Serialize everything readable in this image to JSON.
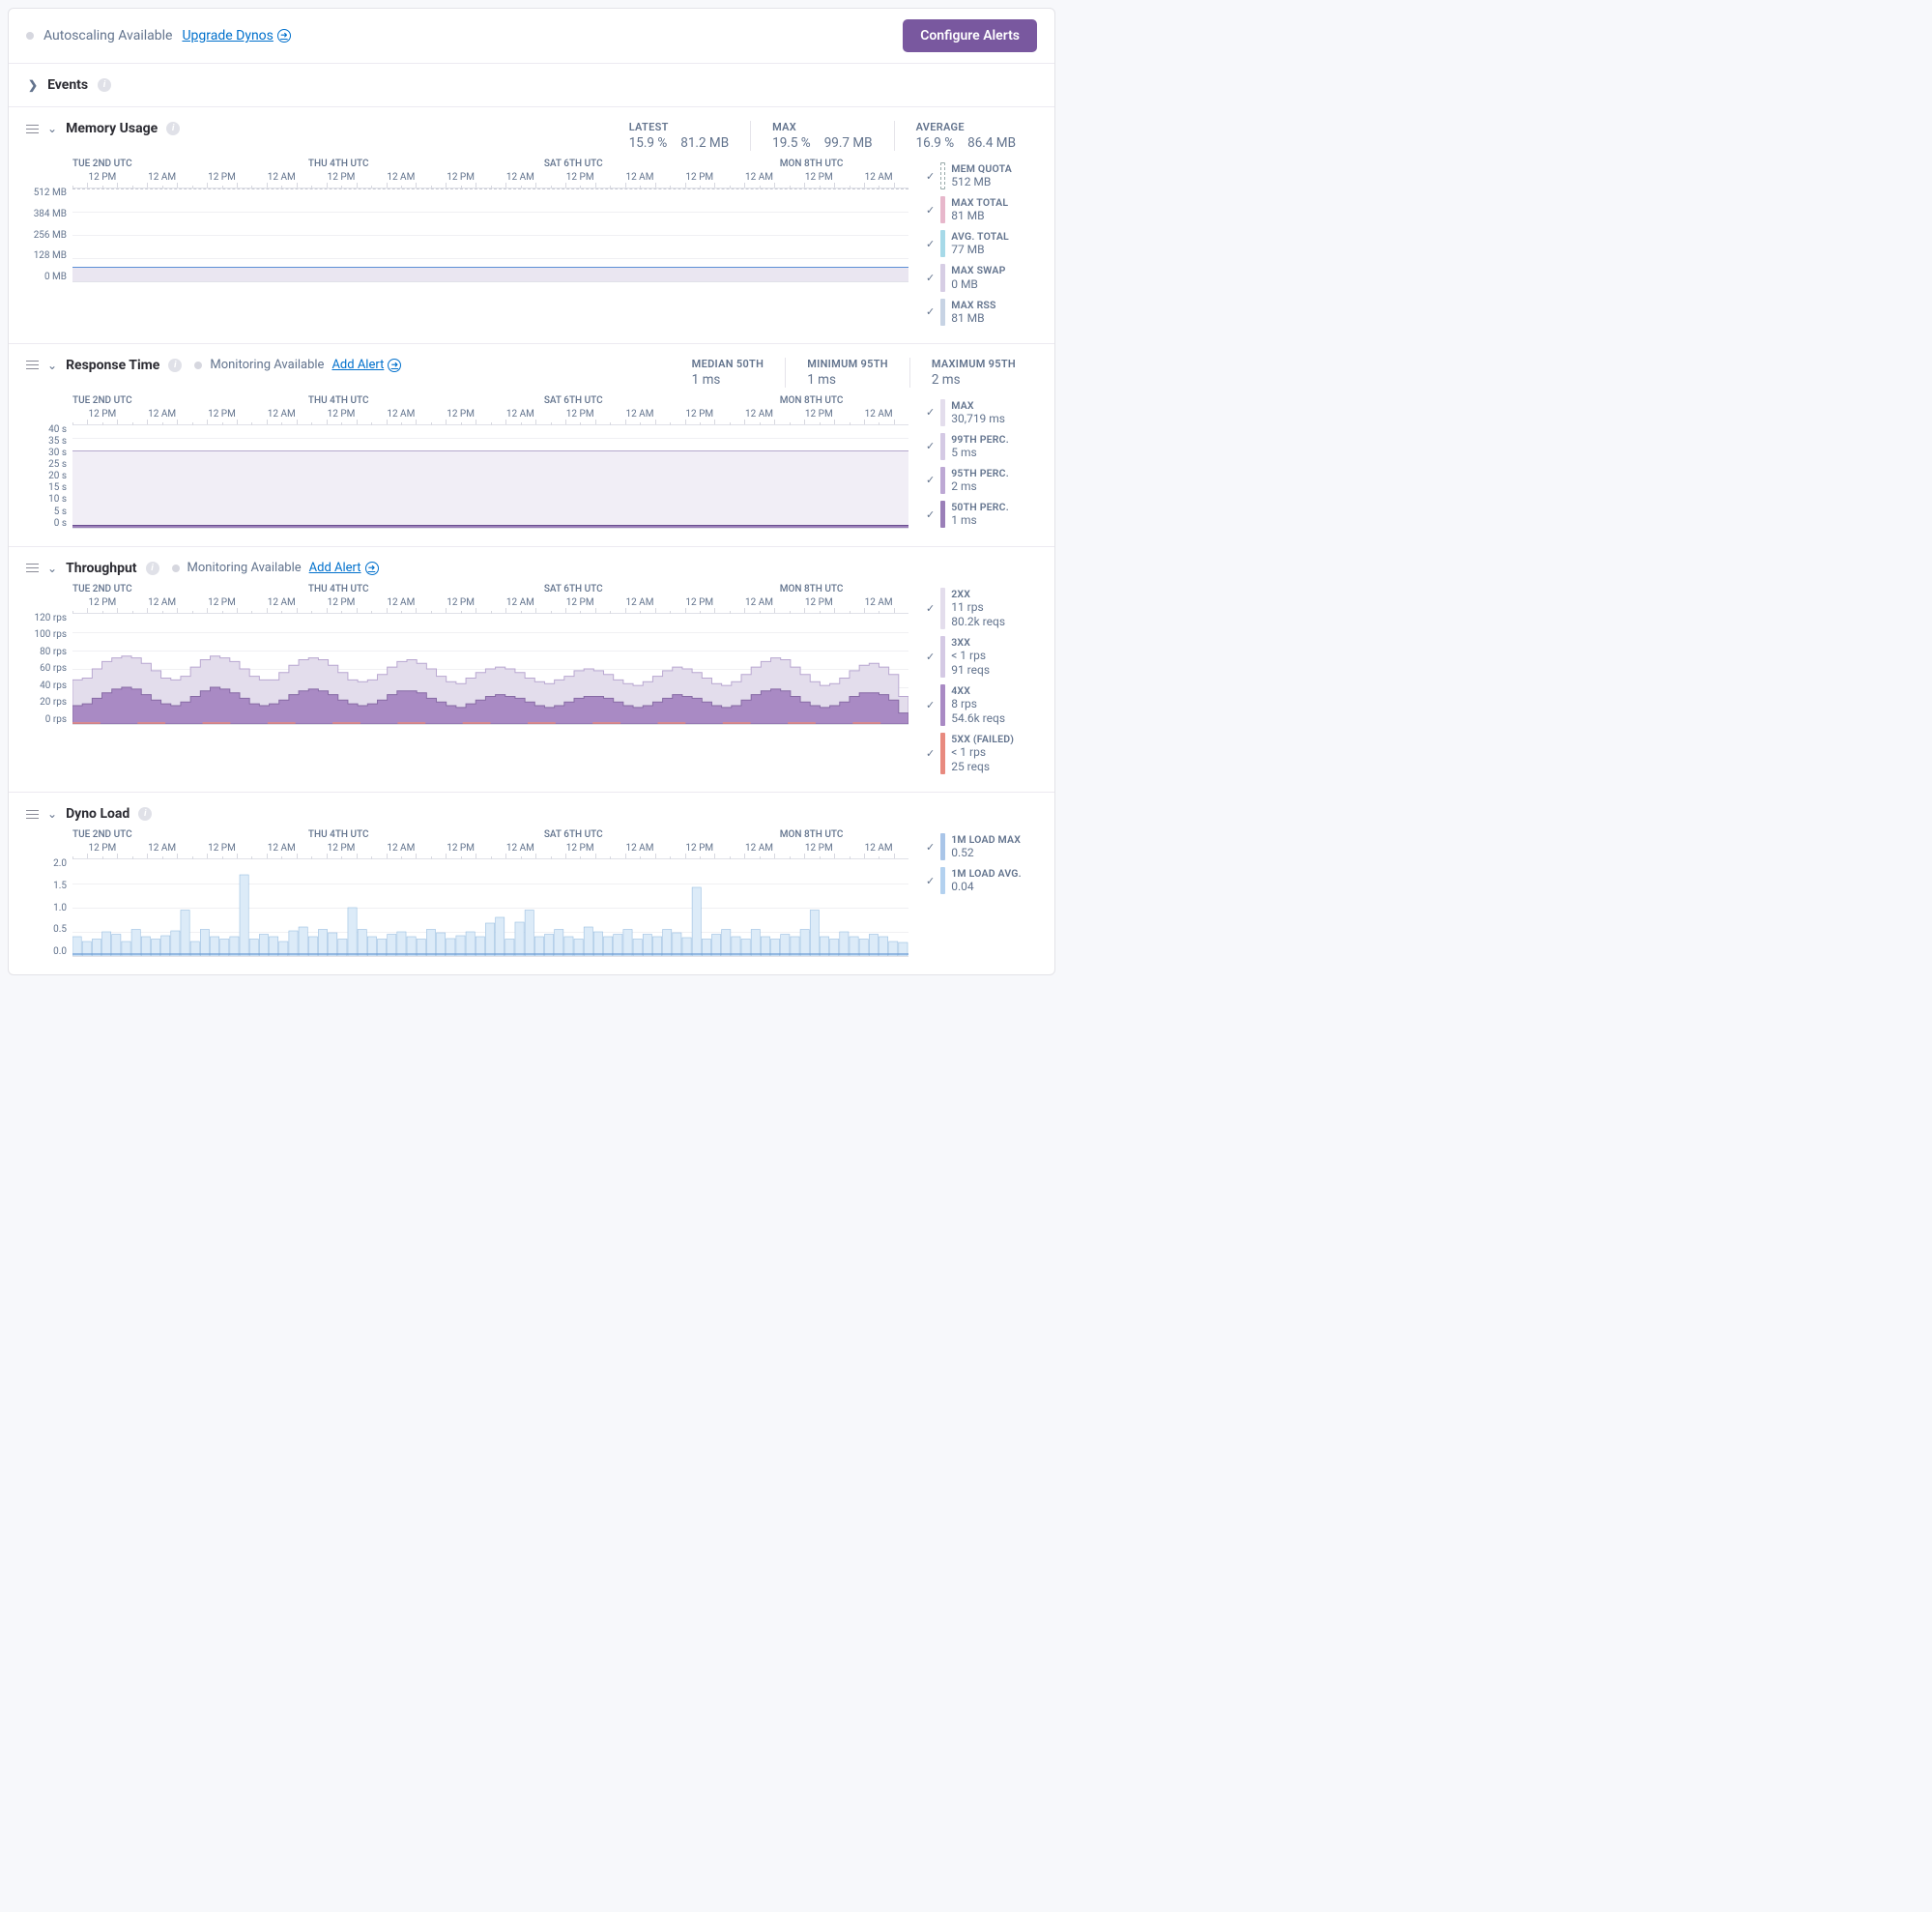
{
  "topbar": {
    "autoscaling_label": "Autoscaling Available",
    "upgrade_label": "Upgrade Dynos",
    "configure_label": "Configure Alerts"
  },
  "events": {
    "label": "Events"
  },
  "time_axis": {
    "days": [
      {
        "label": "TUE 2ND UTC",
        "pct": 0
      },
      {
        "label": "THU 4TH UTC",
        "pct": 28.2
      },
      {
        "label": "SAT 6TH UTC",
        "pct": 56.4
      },
      {
        "label": "MON 8TH UTC",
        "pct": 84.6
      }
    ],
    "ticks": [
      "12 PM",
      "12 AM",
      "12 PM",
      "12 AM",
      "12 PM",
      "12 AM",
      "12 PM",
      "12 AM",
      "12 PM",
      "12 AM",
      "12 PM",
      "12 AM",
      "12 PM",
      "12 AM"
    ]
  },
  "memory": {
    "title": "Memory Usage",
    "stats": {
      "latest_label": "LATEST",
      "latest_pct": "15.9 %",
      "latest_mb": "81.2 MB",
      "max_label": "MAX",
      "max_pct": "19.5 %",
      "max_mb": "99.7 MB",
      "avg_label": "AVERAGE",
      "avg_pct": "16.9 %",
      "avg_mb": "86.4 MB"
    },
    "y_labels": [
      "512 MB",
      "384 MB",
      "256 MB",
      "128 MB",
      "0 MB"
    ],
    "legend": [
      {
        "name": "MEM QUOTA",
        "val": "512 MB",
        "color": "#d9dbe4",
        "dashed": true
      },
      {
        "name": "MAX TOTAL",
        "val": "81 MB",
        "color": "#e7b7cb"
      },
      {
        "name": "AVG. TOTAL",
        "val": "77 MB",
        "color": "#a6d9e8"
      },
      {
        "name": "MAX SWAP",
        "val": "0 MB",
        "color": "#d6cde4"
      },
      {
        "name": "MAX RSS",
        "val": "81 MB",
        "color": "#c7d3e4"
      }
    ],
    "chart_fill_pct": 16
  },
  "response": {
    "title": "Response Time",
    "monitoring_label": "Monitoring Available",
    "addalert_label": "Add Alert",
    "stats": {
      "med_label": "MEDIAN 50TH",
      "med_val": "1 ms",
      "min_label": "MINIMUM 95TH",
      "min_val": "1 ms",
      "max_label": "MAXIMUM 95TH",
      "max_val": "2 ms"
    },
    "y_labels": [
      "40 s",
      "35 s",
      "30 s",
      "25 s",
      "20 s",
      "15 s",
      "10 s",
      "5 s",
      "0 s"
    ],
    "legend": [
      {
        "name": "MAX",
        "val": "30,719 ms",
        "color": "#e3ddec"
      },
      {
        "name": "99TH PERC.",
        "val": "5 ms",
        "color": "#d4c9e4"
      },
      {
        "name": "95TH PERC.",
        "val": "2 ms",
        "color": "#bda8d4"
      },
      {
        "name": "50TH PERC.",
        "val": "1 ms",
        "color": "#9a7fb8"
      }
    ],
    "thirty_line_pct": 25
  },
  "throughput": {
    "title": "Throughput",
    "monitoring_label": "Monitoring Available",
    "addalert_label": "Add Alert",
    "y_labels": [
      "120 rps",
      "100 rps",
      "80 rps",
      "60 rps",
      "40 rps",
      "20 rps",
      "0 rps"
    ],
    "legend": [
      {
        "name": "2XX",
        "val": "11 rps",
        "val2": "80.2k reqs",
        "color": "#e3ddec"
      },
      {
        "name": "3XX",
        "val": "< 1 rps",
        "val2": "91 reqs",
        "color": "#d4c9e4"
      },
      {
        "name": "4XX",
        "val": "8 rps",
        "val2": "54.6k reqs",
        "color": "#a98ac4"
      },
      {
        "name": "5XX (FAILED)",
        "val": "< 1 rps",
        "val2": "25 reqs",
        "color": "#e88a7f"
      }
    ],
    "series_2xx": [
      48,
      50,
      60,
      68,
      72,
      74,
      72,
      66,
      58,
      50,
      48,
      52,
      62,
      70,
      74,
      72,
      68,
      60,
      52,
      48,
      48,
      56,
      64,
      70,
      72,
      70,
      64,
      56,
      48,
      46,
      48,
      54,
      62,
      68,
      70,
      66,
      60,
      52,
      46,
      44,
      50,
      56,
      60,
      62,
      60,
      56,
      50,
      46,
      44,
      48,
      52,
      58,
      60,
      58,
      54,
      48,
      44,
      42,
      46,
      52,
      58,
      62,
      60,
      56,
      50,
      44,
      42,
      46,
      54,
      62,
      68,
      72,
      70,
      62,
      54,
      46,
      42,
      44,
      50,
      58,
      64,
      66,
      62,
      54,
      30
    ],
    "series_4xx": [
      20,
      22,
      28,
      34,
      38,
      40,
      38,
      32,
      26,
      22,
      20,
      24,
      30,
      36,
      40,
      38,
      34,
      28,
      22,
      20,
      22,
      26,
      32,
      36,
      38,
      36,
      32,
      26,
      22,
      20,
      22,
      26,
      32,
      36,
      36,
      34,
      28,
      24,
      20,
      18,
      22,
      26,
      30,
      32,
      30,
      28,
      24,
      20,
      18,
      20,
      24,
      28,
      30,
      30,
      28,
      24,
      20,
      18,
      20,
      24,
      28,
      32,
      30,
      28,
      24,
      20,
      18,
      20,
      26,
      32,
      36,
      38,
      36,
      30,
      24,
      20,
      18,
      20,
      24,
      30,
      34,
      34,
      32,
      26,
      12
    ],
    "x_range": [
      0,
      120
    ]
  },
  "dyno": {
    "title": "Dyno Load",
    "y_labels": [
      "2.0",
      "1.5",
      "1.0",
      "0.5",
      "0.0"
    ],
    "legend": [
      {
        "name": "1M LOAD MAX",
        "val": "0.52",
        "color": "#a9c5e8"
      },
      {
        "name": "1M LOAD AVG.",
        "val": "0.04",
        "color": "#b3d1ef"
      }
    ],
    "series_max": [
      0.4,
      0.3,
      0.35,
      0.5,
      0.45,
      0.3,
      0.55,
      0.4,
      0.35,
      0.42,
      0.52,
      0.95,
      0.3,
      0.55,
      0.4,
      0.35,
      0.4,
      1.68,
      0.35,
      0.45,
      0.4,
      0.3,
      0.52,
      0.6,
      0.4,
      0.55,
      0.48,
      0.35,
      1.0,
      0.55,
      0.4,
      0.35,
      0.45,
      0.5,
      0.4,
      0.35,
      0.55,
      0.48,
      0.36,
      0.42,
      0.5,
      0.4,
      0.68,
      0.8,
      0.35,
      0.7,
      0.95,
      0.4,
      0.45,
      0.55,
      0.4,
      0.35,
      0.6,
      0.5,
      0.4,
      0.45,
      0.55,
      0.35,
      0.45,
      0.4,
      0.55,
      0.48,
      0.38,
      1.42,
      0.35,
      0.45,
      0.55,
      0.4,
      0.35,
      0.55,
      0.4,
      0.35,
      0.45,
      0.4,
      0.55,
      0.95,
      0.4,
      0.35,
      0.5,
      0.4,
      0.35,
      0.45,
      0.4,
      0.3,
      0.28
    ],
    "avg_line": 0.04,
    "x_range": [
      0,
      2.0
    ]
  },
  "chart_data": [
    {
      "type": "area",
      "title": "Memory Usage",
      "ylabel": "MB",
      "ylim": [
        0,
        512
      ],
      "series": [
        {
          "name": "Max RSS",
          "value_approx": 81
        }
      ]
    },
    {
      "type": "line",
      "title": "Response Time",
      "ylabel": "s",
      "ylim": [
        0,
        40
      ],
      "series": [
        {
          "name": "50th",
          "value_approx_ms": 1
        },
        {
          "name": "95th",
          "value_approx_ms": 2
        },
        {
          "name": "99th",
          "value_approx_ms": 5
        },
        {
          "name": "Max",
          "value_approx_ms": 30719
        }
      ]
    },
    {
      "type": "area",
      "title": "Throughput",
      "ylabel": "rps",
      "ylim": [
        0,
        120
      ],
      "series": [
        {
          "name": "2XX",
          "approx_range": [
            30,
            74
          ]
        },
        {
          "name": "4XX",
          "approx_range": [
            12,
            40
          ]
        }
      ]
    },
    {
      "type": "bar",
      "title": "Dyno Load",
      "ylabel": "",
      "ylim": [
        0,
        2.0
      ],
      "series": [
        {
          "name": "1M Load Max",
          "approx_typical": 0.45,
          "spikes": [
            1.68,
            1.42
          ]
        },
        {
          "name": "1M Load Avg",
          "value": 0.04
        }
      ]
    }
  ]
}
